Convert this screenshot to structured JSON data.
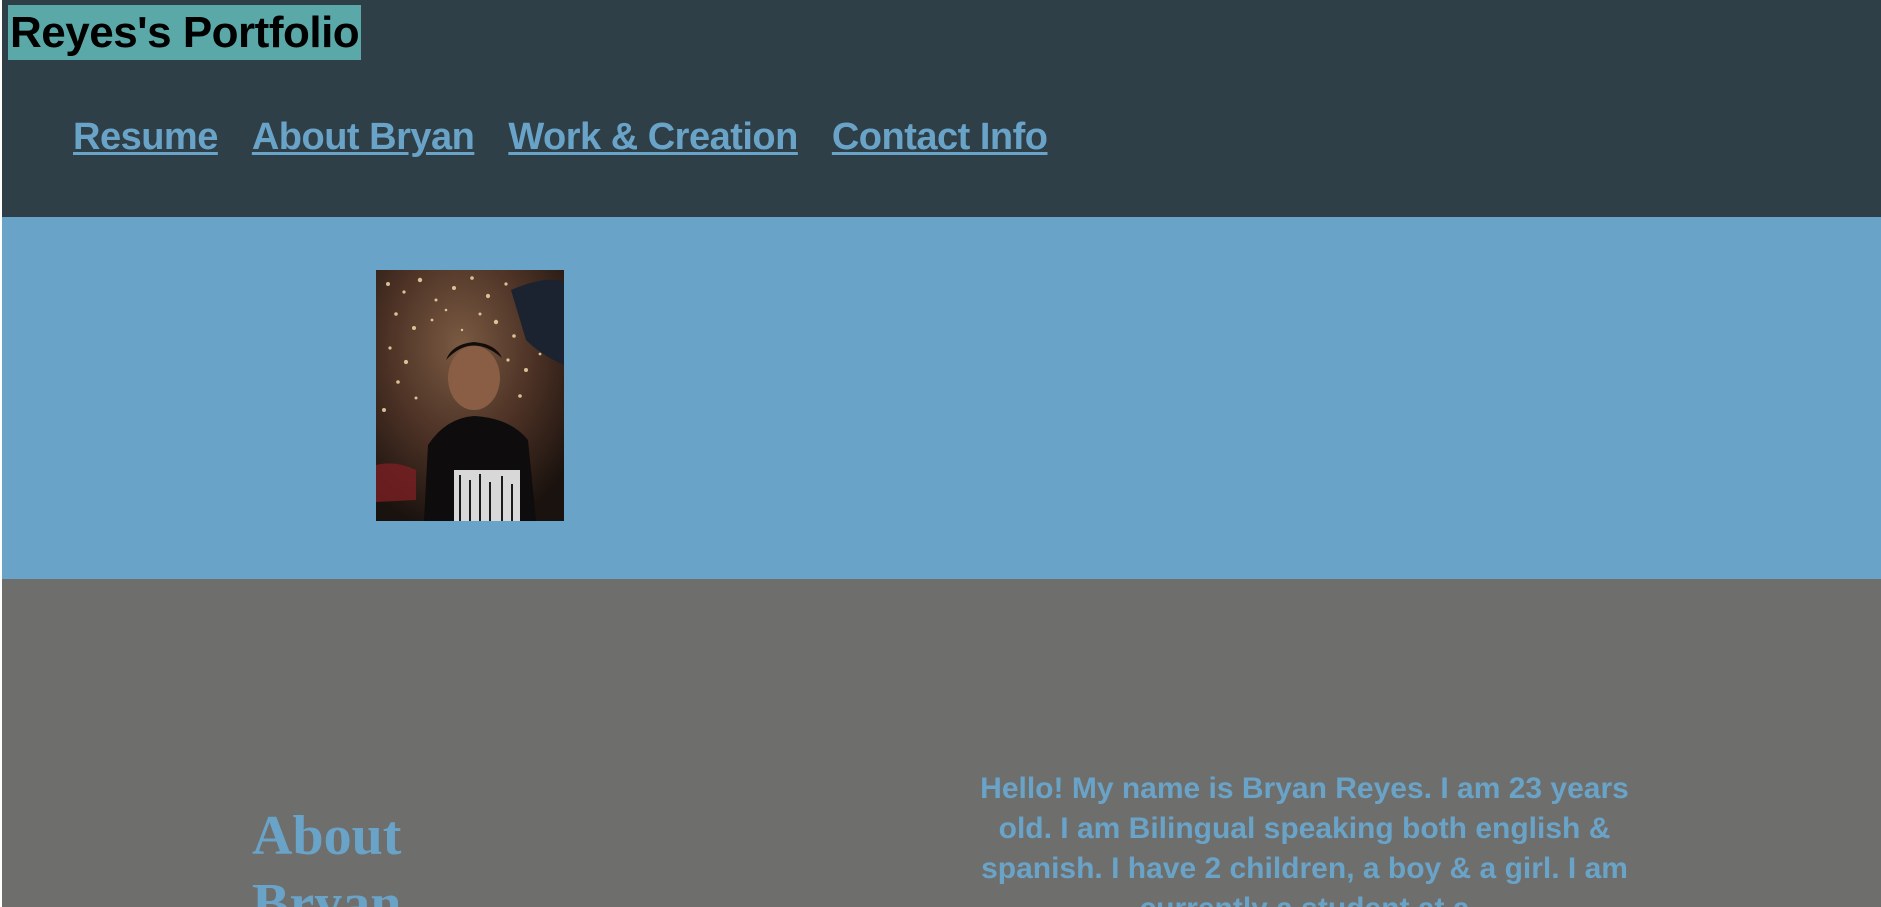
{
  "header": {
    "site_title": "Reyes's Portfolio",
    "nav": [
      {
        "label": "Resume"
      },
      {
        "label": "About Bryan"
      },
      {
        "label": "Work & Creation"
      },
      {
        "label": "Contact Info"
      }
    ]
  },
  "hero": {
    "portrait_alt": "Photo of Bryan Reyes"
  },
  "about": {
    "heading": "About Bryan",
    "body": "Hello! My name is Bryan Reyes. I am 23 years old. I am Bilingual speaking both english & spanish. I have 2 children, a boy & a girl. I am currently a student at a"
  },
  "colors": {
    "header_bg": "#2f3f48",
    "title_bg": "#5aa9a8",
    "accent": "#6aa3c8",
    "about_bg": "#6e6e6c"
  }
}
